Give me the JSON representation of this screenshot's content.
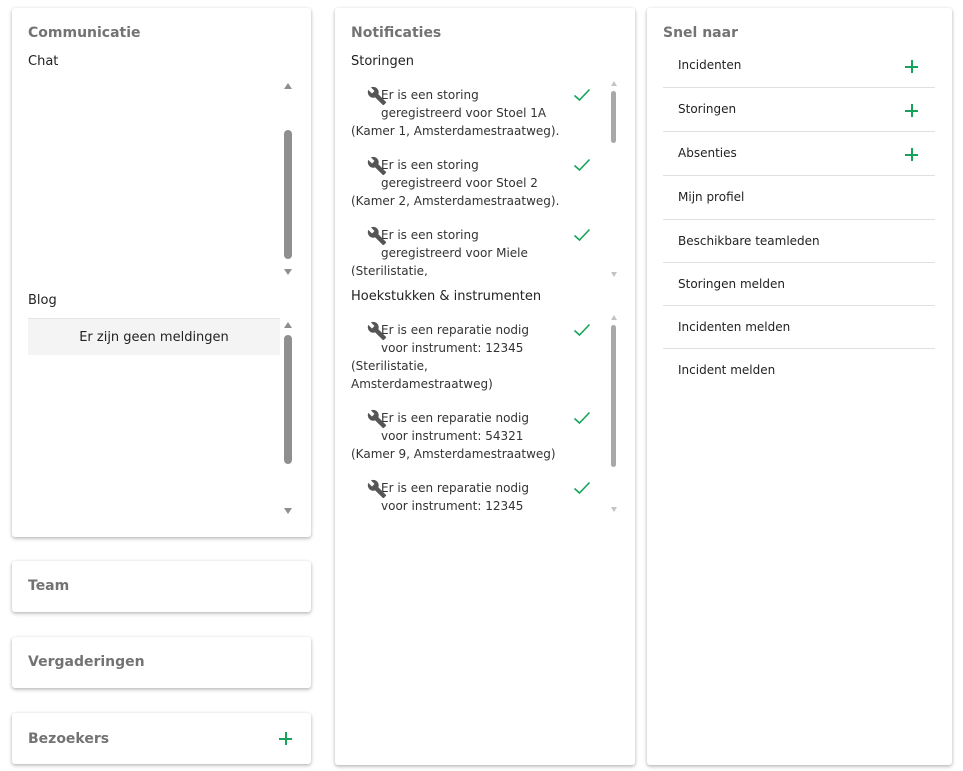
{
  "communicatie": {
    "title": "Communicatie",
    "chat_title": "Chat",
    "blog_title": "Blog",
    "blog_empty": "Er zijn geen meldingen"
  },
  "team": {
    "title": "Team"
  },
  "vergaderingen": {
    "title": "Vergaderingen"
  },
  "bezoekers": {
    "title": "Bezoekers"
  },
  "notificaties": {
    "title": "Notificaties",
    "storingen": {
      "title": "Storingen",
      "items": [
        {
          "line1": "Er is een storing",
          "line2": "geregistreerd voor Stoel 1A",
          "line3": "(Kamer 1, Amsterdamestraatweg)."
        },
        {
          "line1": "Er is een storing",
          "line2": "geregistreerd voor Stoel 2",
          "line3": "(Kamer 2, Amsterdamestraatweg)."
        },
        {
          "line1": "Er is een storing",
          "line2": "geregistreerd voor Miele",
          "line3": "(Sterilistatie,"
        }
      ]
    },
    "hoekstukken": {
      "title": "Hoekstukken & instrumenten",
      "items": [
        {
          "line1": "Er is een reparatie nodig",
          "line2": "voor instrument: 12345",
          "line3": "(Sterilistatie,",
          "line4": "Amsterdamestraatweg)"
        },
        {
          "line1": "Er is een reparatie nodig",
          "line2": "voor instrument: 54321",
          "line3": "(Kamer 9, Amsterdamestraatweg)"
        },
        {
          "line1": "Er is een reparatie nodig",
          "line2": "voor instrument: 12345"
        }
      ]
    }
  },
  "snel_naar": {
    "title": "Snel naar",
    "items": [
      {
        "label": "Incidenten"
      },
      {
        "label": "Storingen"
      },
      {
        "label": "Absenties"
      },
      {
        "label": "Mijn profiel"
      },
      {
        "label": "Beschikbare teamleden"
      },
      {
        "label": "Storingen melden"
      },
      {
        "label": "Incidenten melden"
      },
      {
        "label": "Incident melden"
      }
    ]
  },
  "icons": {
    "add": "plus-icon",
    "repair": "wrench-icon",
    "done": "check-icon"
  },
  "colors": {
    "accent": "#17a35b",
    "title": "#737373",
    "scrollbar": "#8f8f8f"
  }
}
